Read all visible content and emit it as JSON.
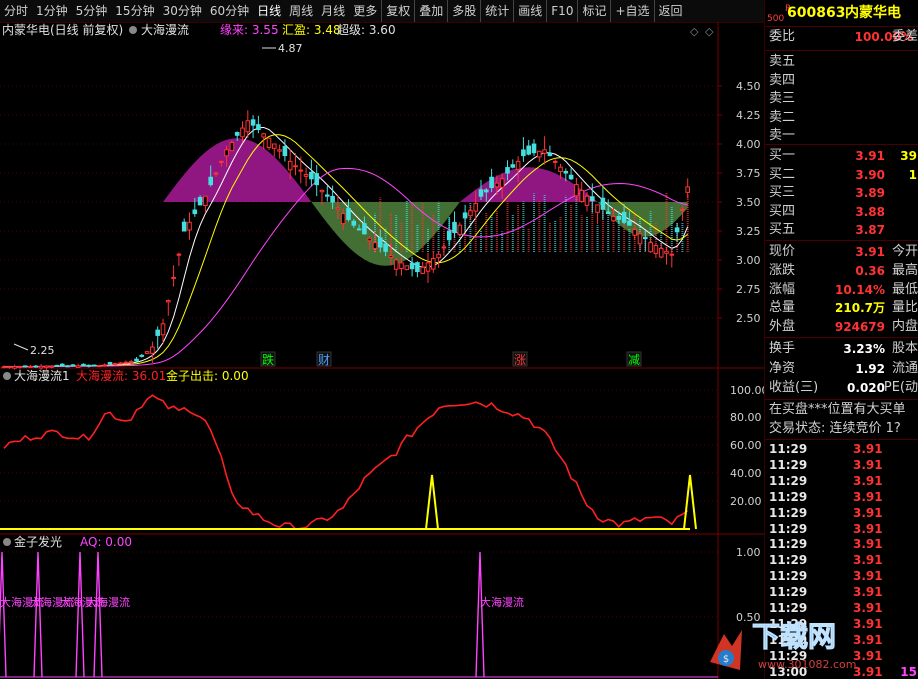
{
  "toolbar": {
    "periods": [
      "分时",
      "1分钟",
      "5分钟",
      "15分钟",
      "30分钟",
      "60分钟",
      "日线",
      "周线",
      "月线",
      "更多"
    ],
    "active_period": "日线",
    "actions": [
      "复权",
      "叠加",
      "多股",
      "统计",
      "画线",
      "F10",
      "标记",
      "+自选",
      "返回"
    ]
  },
  "main_chart": {
    "stock_title": "内蒙华电(日线 前复权)",
    "indicator_name": "大海漫流",
    "params": [
      {
        "label": "缘来: 3.55",
        "color": "#ff44ff"
      },
      {
        "label": "汇盈: 3.48",
        "color": "#ffff00"
      },
      {
        "label": "超级: 3.60",
        "color": "#e0e0e0"
      }
    ],
    "high_label": "4.87",
    "low_label": "2.25",
    "y_axis": [
      "4.50",
      "4.25",
      "4.00",
      "3.75",
      "3.50",
      "3.25",
      "3.00",
      "2.75",
      "2.50"
    ],
    "signals": [
      {
        "text": "跌",
        "color": "#00ff00"
      },
      {
        "text": "财",
        "color": "#4aa0ff"
      },
      {
        "text": "涨",
        "color": "#ff3333"
      },
      {
        "text": "减",
        "color": "#00ff00"
      }
    ]
  },
  "sub1": {
    "title": "大海漫流1",
    "value_label": "大海漫流: 36.01",
    "value_color": "#ff2020",
    "extra_label": "金子出击: 0.00",
    "y_axis": [
      "100.00",
      "80.00",
      "60.00",
      "40.00",
      "20.00"
    ]
  },
  "sub2": {
    "title": "金子发光",
    "value_label": "AQ: 0.00",
    "y_axis": [
      "1.00",
      "0.50"
    ],
    "labels": [
      "大海漫流",
      "大海漫流",
      "大海漫流",
      "大海漫流",
      "大海漫流"
    ]
  },
  "panel": {
    "r_badge": "R",
    "level": "500",
    "code": "600863",
    "name": "内蒙华电",
    "weibi_label": "委比",
    "weibi_value": "100.00%",
    "weibi_extra": "委差",
    "sells": [
      {
        "label": "卖五",
        "price": "",
        "vol": ""
      },
      {
        "label": "卖四",
        "price": "",
        "vol": ""
      },
      {
        "label": "卖三",
        "price": "",
        "vol": ""
      },
      {
        "label": "卖二",
        "price": "",
        "vol": ""
      },
      {
        "label": "卖一",
        "price": "",
        "vol": ""
      }
    ],
    "buys": [
      {
        "label": "买一",
        "price": "3.91",
        "vol": "39"
      },
      {
        "label": "买二",
        "price": "3.90",
        "vol": "1"
      },
      {
        "label": "买三",
        "price": "3.89",
        "vol": ""
      },
      {
        "label": "买四",
        "price": "3.88",
        "vol": ""
      },
      {
        "label": "买五",
        "price": "3.87",
        "vol": ""
      }
    ],
    "stats1": [
      {
        "label": "现价",
        "value": "3.91",
        "extra": "今开",
        "color": "#ff3333"
      },
      {
        "label": "涨跌",
        "value": "0.36",
        "extra": "最高",
        "color": "#ff3333"
      },
      {
        "label": "涨幅",
        "value": "10.14%",
        "extra": "最低",
        "color": "#ff3333"
      },
      {
        "label": "总量",
        "value": "210.7万",
        "extra": "量比",
        "color": "#ffff00"
      },
      {
        "label": "外盘",
        "value": "924679",
        "extra": "内盘",
        "color": "#ff3333"
      }
    ],
    "stats2": [
      {
        "label": "换手",
        "value": "3.23%",
        "extra": "股本",
        "color": "#ffffff"
      },
      {
        "label": "净资",
        "value": "1.92",
        "extra": "流通",
        "color": "#ffffff"
      },
      {
        "label": "收益(三)",
        "value": "0.020",
        "extra": "PE(动",
        "color": "#ffffff"
      }
    ],
    "notice1": "在买盘***位置有大买单",
    "notice2": "交易状态: 连续竞价 1?",
    "ticks": [
      {
        "time": "11:29",
        "price": "3.91"
      },
      {
        "time": "11:29",
        "price": "3.91"
      },
      {
        "time": "11:29",
        "price": "3.91"
      },
      {
        "time": "11:29",
        "price": "3.91"
      },
      {
        "time": "11:29",
        "price": "3.91"
      },
      {
        "time": "11:29",
        "price": "3.91"
      },
      {
        "time": "11:29",
        "price": "3.91"
      },
      {
        "time": "11:29",
        "price": "3.91"
      },
      {
        "time": "11:29",
        "price": "3.91"
      },
      {
        "time": "11:29",
        "price": "3.91"
      },
      {
        "time": "11:29",
        "price": "3.91"
      },
      {
        "time": "11:29",
        "price": "3.91"
      },
      {
        "time": "11:29",
        "price": "3.91"
      },
      {
        "time": "11:29",
        "price": "3.91"
      },
      {
        "time": "13:00",
        "price": "3.91",
        "vol": "15"
      }
    ]
  },
  "watermark": {
    "brand": "下载网",
    "url": "www.301082.com"
  },
  "colors": {
    "up": "#ff3333",
    "down": "#44e0e0",
    "grid": "#7a0000",
    "cloud_pos": "#a01a90",
    "cloud_neg": "#4a7a3a",
    "ma_short": "#ffffff",
    "ma_mid": "#ffff00",
    "ma_long": "#ff44ff"
  }
}
